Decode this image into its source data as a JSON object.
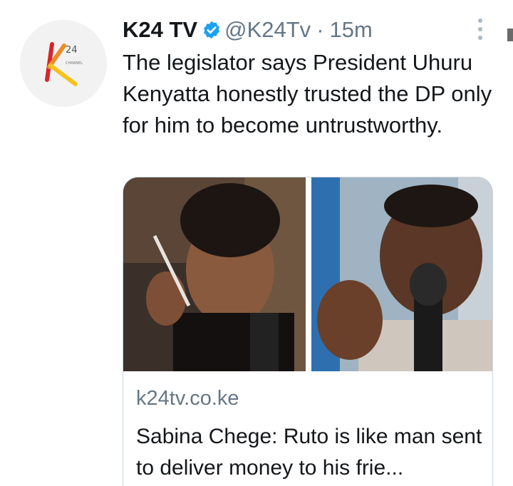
{
  "tweet": {
    "author_name": "K24 TV",
    "handle": "@K24Tv",
    "separator": "·",
    "time": "15m",
    "text": "The legislator says President Uhuru Kenyatta honestly trusted the DP only for him to become untrustworthy."
  },
  "avatar": {
    "logo_text": "24",
    "logo_small_text": "CHANNEL",
    "icon": "k24-logo"
  },
  "card": {
    "domain": "k24tv.co.ke",
    "title": "Sabina Chege: Ruto is like man sent to deliver money to his frie..."
  },
  "colors": {
    "verified_blue": "#1da1f2",
    "secondary_text": "#657786",
    "primary_text": "#14171a",
    "border": "#ccd6dd",
    "logo_orange": "#f08a24",
    "logo_red": "#d6262b",
    "logo_yellow": "#f7c21b"
  }
}
